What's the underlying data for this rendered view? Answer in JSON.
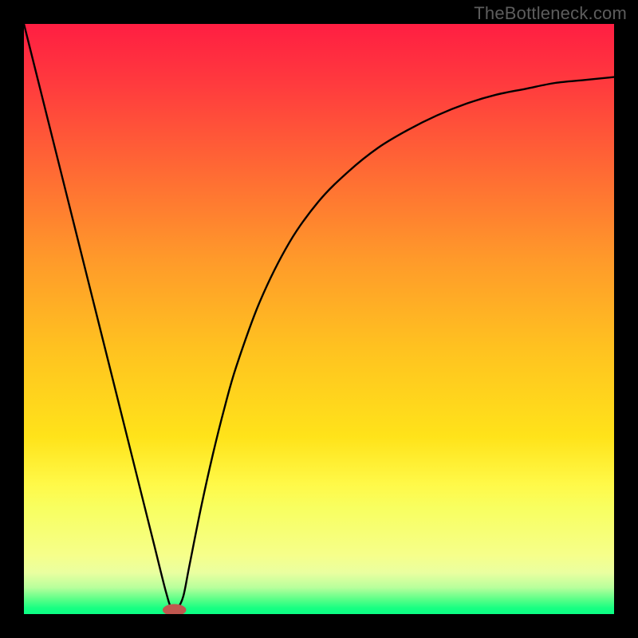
{
  "watermark": "TheBottleneck.com",
  "chart_data": {
    "type": "line",
    "title": "",
    "xlabel": "",
    "ylabel": "",
    "xlim": [
      0,
      100
    ],
    "ylim": [
      0,
      100
    ],
    "grid": false,
    "legend": false,
    "series": [
      {
        "name": "curve",
        "color": "#000000",
        "x": [
          0,
          4,
          8,
          12,
          16,
          20,
          22,
          24,
          25,
          26,
          27,
          28,
          30,
          32,
          34,
          36,
          40,
          45,
          50,
          55,
          60,
          65,
          70,
          75,
          80,
          85,
          90,
          95,
          100
        ],
        "y": [
          100,
          84,
          68,
          52,
          36,
          20,
          12,
          4,
          1,
          1,
          3,
          8,
          18,
          27,
          35,
          42,
          53,
          63,
          70,
          75,
          79,
          82,
          84.5,
          86.5,
          88,
          89,
          90,
          90.5,
          91
        ]
      }
    ],
    "background_gradient": {
      "type": "vertical",
      "stops": [
        {
          "offset": 0.0,
          "color": "#ff1e42"
        },
        {
          "offset": 0.1,
          "color": "#ff3a3e"
        },
        {
          "offset": 0.25,
          "color": "#ff6a34"
        },
        {
          "offset": 0.4,
          "color": "#ff9a2a"
        },
        {
          "offset": 0.55,
          "color": "#ffc220"
        },
        {
          "offset": 0.7,
          "color": "#ffe31a"
        },
        {
          "offset": 0.78,
          "color": "#fff948"
        },
        {
          "offset": 0.82,
          "color": "#f8ff60"
        },
        {
          "offset": 0.9,
          "color": "#f6ff8a"
        },
        {
          "offset": 0.93,
          "color": "#eaffa0"
        },
        {
          "offset": 0.955,
          "color": "#b8ff9c"
        },
        {
          "offset": 0.975,
          "color": "#5aff88"
        },
        {
          "offset": 0.99,
          "color": "#17ff82"
        },
        {
          "offset": 1.0,
          "color": "#0bff84"
        }
      ]
    },
    "marker": {
      "name": "min-point",
      "x": 25.5,
      "y": 0.7,
      "rx": 2.0,
      "ry": 1.0,
      "color": "#c0574f"
    }
  }
}
